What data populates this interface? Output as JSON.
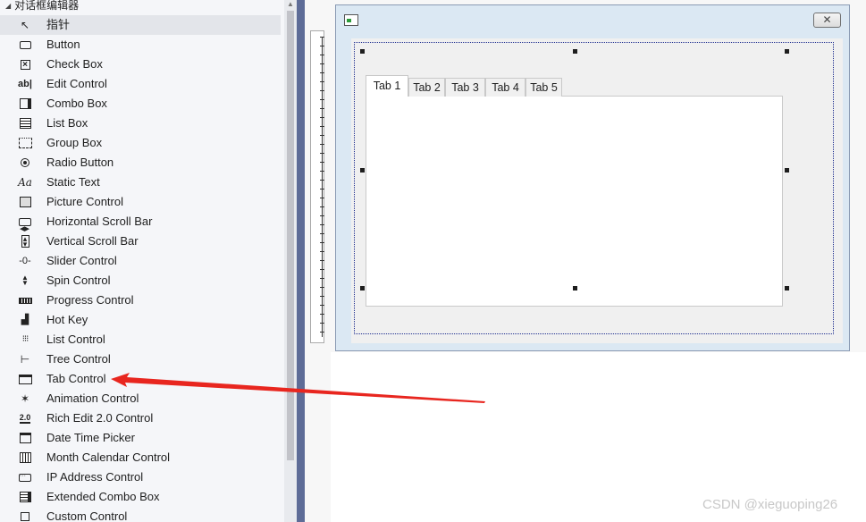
{
  "toolbox": {
    "header": "对话框编辑器",
    "items": [
      {
        "label": "指针",
        "icon": "pointer-icon",
        "selected": true
      },
      {
        "label": "Button",
        "icon": "button-icon"
      },
      {
        "label": "Check Box",
        "icon": "checkbox-icon"
      },
      {
        "label": "Edit Control",
        "icon": "edit-control-icon",
        "glyph": "ab|"
      },
      {
        "label": "Combo Box",
        "icon": "combo-box-icon"
      },
      {
        "label": "List Box",
        "icon": "list-box-icon"
      },
      {
        "label": "Group Box",
        "icon": "group-box-icon"
      },
      {
        "label": "Radio Button",
        "icon": "radio-button-icon"
      },
      {
        "label": "Static Text",
        "icon": "static-text-icon",
        "glyph": "Aa"
      },
      {
        "label": "Picture Control",
        "icon": "picture-control-icon"
      },
      {
        "label": "Horizontal Scroll Bar",
        "icon": "horizontal-scrollbar-icon"
      },
      {
        "label": "Vertical Scroll Bar",
        "icon": "vertical-scrollbar-icon"
      },
      {
        "label": "Slider Control",
        "icon": "slider-icon"
      },
      {
        "label": "Spin Control",
        "icon": "spin-icon"
      },
      {
        "label": "Progress Control",
        "icon": "progress-icon"
      },
      {
        "label": "Hot Key",
        "icon": "hot-key-icon"
      },
      {
        "label": "List Control",
        "icon": "list-control-icon"
      },
      {
        "label": "Tree Control",
        "icon": "tree-control-icon"
      },
      {
        "label": "Tab Control",
        "icon": "tab-control-icon"
      },
      {
        "label": "Animation Control",
        "icon": "animation-icon"
      },
      {
        "label": "Rich Edit 2.0 Control",
        "icon": "rich-edit-icon",
        "glyph": "2.0"
      },
      {
        "label": "Date Time Picker",
        "icon": "date-time-picker-icon"
      },
      {
        "label": "Month Calendar Control",
        "icon": "month-calendar-icon"
      },
      {
        "label": "IP Address Control",
        "icon": "ip-address-icon"
      },
      {
        "label": "Extended Combo Box",
        "icon": "extended-combo-icon"
      },
      {
        "label": "Custom Control",
        "icon": "custom-control-icon"
      }
    ]
  },
  "dialog": {
    "close_glyph": "✕",
    "tabs": [
      "Tab 1",
      "Tab 2",
      "Tab 3",
      "Tab 4",
      "Tab 5"
    ],
    "active_tab": 0
  },
  "annotation": {
    "color": "#e8261f"
  },
  "watermark": "CSDN @xieguoping26"
}
